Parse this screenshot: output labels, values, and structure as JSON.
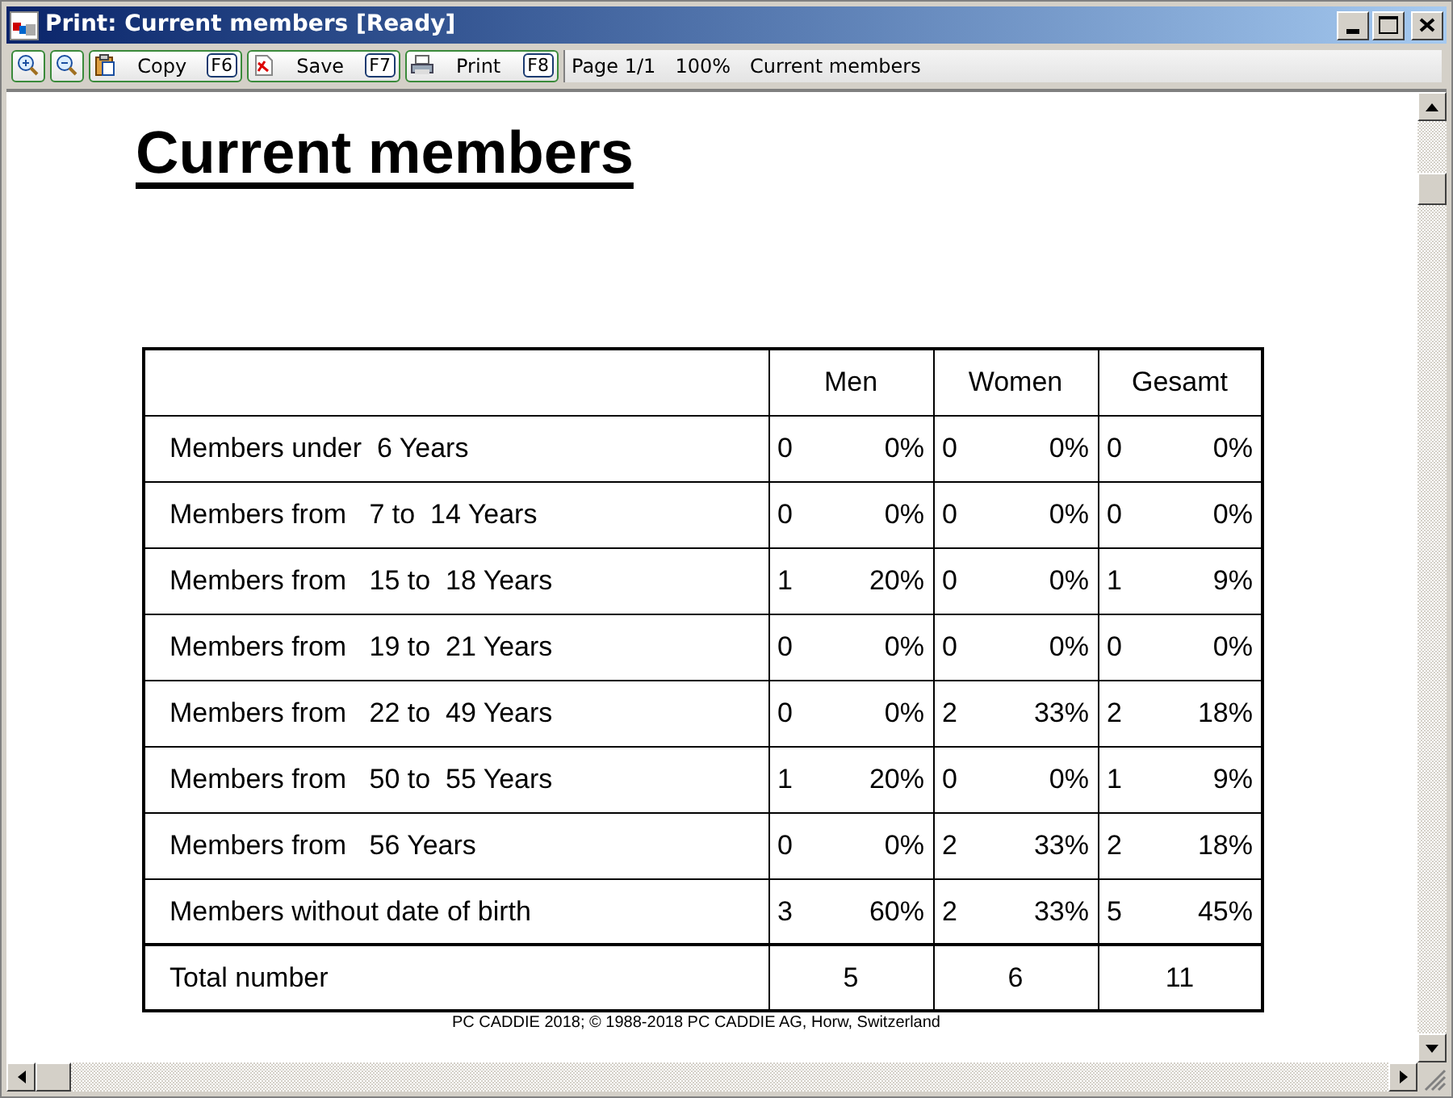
{
  "window": {
    "title": "Print: Current members [Ready]"
  },
  "toolbar": {
    "buttons": [
      {
        "kind": "zoom-in"
      },
      {
        "kind": "zoom-out"
      },
      {
        "kind": "copy",
        "label": "Copy",
        "key": "F6"
      },
      {
        "kind": "save",
        "label": "Save",
        "key": "F7"
      },
      {
        "kind": "print",
        "label": "Print",
        "key": "F8"
      }
    ],
    "page": "Page 1/1",
    "zoom": "100%",
    "document": "Current members"
  },
  "report": {
    "title": "Current members",
    "columns": [
      "Men",
      "Women",
      "Gesamt"
    ],
    "rows": [
      {
        "label": "Members under  6 Years",
        "cells": [
          [
            "0",
            "0%"
          ],
          [
            "0",
            "0%"
          ],
          [
            "0",
            "0%"
          ]
        ]
      },
      {
        "label": "Members from   7 to  14 Years",
        "cells": [
          [
            "0",
            "0%"
          ],
          [
            "0",
            "0%"
          ],
          [
            "0",
            "0%"
          ]
        ]
      },
      {
        "label": "Members from   15 to  18 Years",
        "cells": [
          [
            "1",
            "20%"
          ],
          [
            "0",
            "0%"
          ],
          [
            "1",
            "9%"
          ]
        ]
      },
      {
        "label": "Members from   19 to  21 Years",
        "cells": [
          [
            "0",
            "0%"
          ],
          [
            "0",
            "0%"
          ],
          [
            "0",
            "0%"
          ]
        ]
      },
      {
        "label": "Members from   22 to  49 Years",
        "cells": [
          [
            "0",
            "0%"
          ],
          [
            "2",
            "33%"
          ],
          [
            "2",
            "18%"
          ]
        ]
      },
      {
        "label": "Members from   50 to  55 Years",
        "cells": [
          [
            "1",
            "20%"
          ],
          [
            "0",
            "0%"
          ],
          [
            "1",
            "9%"
          ]
        ]
      },
      {
        "label": "Members from   56 Years",
        "cells": [
          [
            "0",
            "0%"
          ],
          [
            "2",
            "33%"
          ],
          [
            "2",
            "18%"
          ]
        ]
      },
      {
        "label": "Members without date of birth",
        "cells": [
          [
            "3",
            "60%"
          ],
          [
            "2",
            "33%"
          ],
          [
            "5",
            "45%"
          ]
        ]
      }
    ],
    "total": {
      "label": "Total number",
      "values": [
        "5",
        "6",
        "11"
      ]
    },
    "footer": "PC CADDIE 2018; © 1988-2018 PC CADDIE AG, Horw, Switzerland"
  }
}
